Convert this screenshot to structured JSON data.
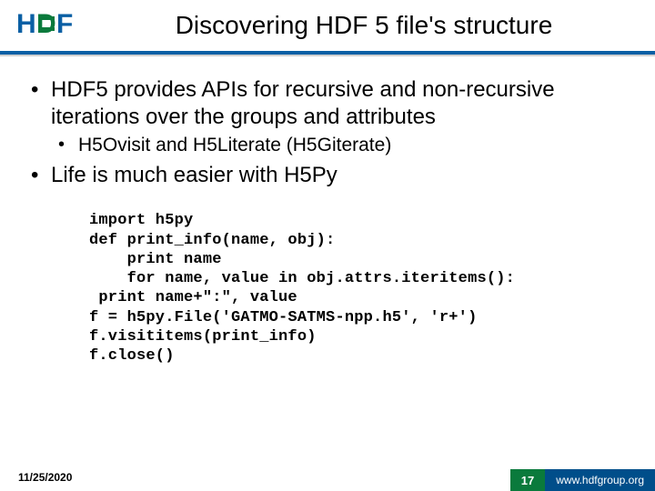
{
  "header": {
    "title": "Discovering HDF 5 file's structure"
  },
  "bullets": {
    "b1": "HDF5 provides APIs for recursive and non-recursive iterations over the groups and attributes",
    "b1a": "H5Ovisit and H5Literate (H5Giterate)",
    "b2": "Life is much easier with H5Py"
  },
  "code": "import h5py\ndef print_info(name, obj):\n    print name\n    for name, value in obj.attrs.iteritems():\n print name+\":\", value\nf = h5py.File('GATMO-SATMS-npp.h5', 'r+')\nf.visititems(print_info)\nf.close()",
  "footer": {
    "date": "11/25/2020",
    "page": "17",
    "brand": "www.hdfgroup.org"
  }
}
